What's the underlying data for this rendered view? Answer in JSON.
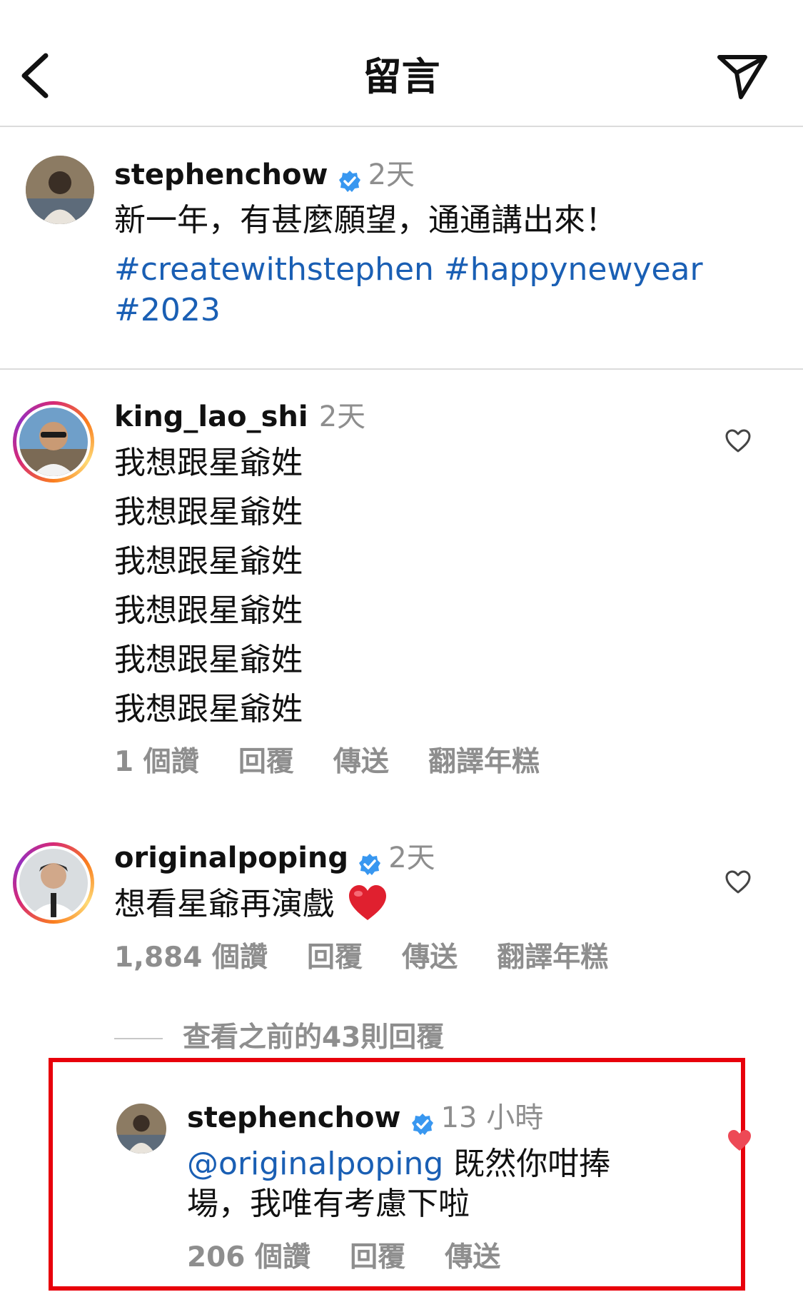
{
  "header": {
    "title": "留言",
    "back_icon": "chevron-left-icon",
    "share_icon": "paper-plane-icon"
  },
  "caption": {
    "username": "stephenchow",
    "time": "2天",
    "text": "新一年，有甚麼願望，通通講出來！",
    "hashtags_line1": "#createwithstephen #happynewyear",
    "hashtags_line2": "#2023"
  },
  "comments": [
    {
      "username": "king_lao_shi",
      "time": "2天",
      "lines": [
        "我想跟星爺姓",
        "我想跟星爺姓",
        "我想跟星爺姓",
        "我想跟星爺姓",
        "我想跟星爺姓",
        "我想跟星爺姓"
      ],
      "likes": "1 個讚",
      "reply": "回覆",
      "send": "傳送",
      "translate": "翻譯年糕"
    },
    {
      "username": "originalpoping",
      "time": "2天",
      "text": "想看星爺再演戲",
      "likes": "1,884 個讚",
      "reply": "回覆",
      "send": "傳送",
      "translate": "翻譯年糕"
    }
  ],
  "view_replies": "查看之前的43則回覆",
  "reply": {
    "username": "stephenchow",
    "time": "13 小時",
    "mention": "@originalpoping",
    "text_part1": " 既然你咁捧",
    "text_part2": "場，我唯有考慮下啦",
    "likes": "206 個讚",
    "reply": "回覆",
    "send": "傳送"
  },
  "colors": {
    "hashtag": "#1a5fb4",
    "verified": "#3897f0",
    "highlight_box": "#e8000b",
    "liked_heart": "#ed4956",
    "muted": "#8e8e8e"
  }
}
